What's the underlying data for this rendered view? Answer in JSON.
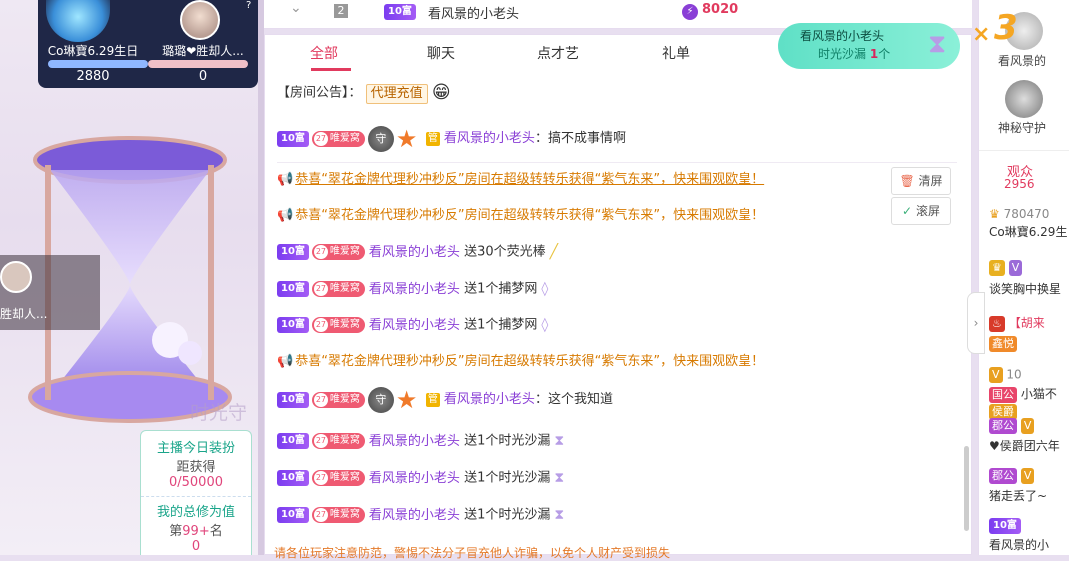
{
  "topbar": {
    "chevron": "⌄",
    "rank": "2",
    "level": "10富",
    "name": "看风景的小老头",
    "score": "8020"
  },
  "pk": {
    "left_name": "Co琳寶6.29生日",
    "left_score": "2880",
    "right_name": "璐璐❤胜却人...",
    "right_score": "0",
    "help": "?"
  },
  "stream": {
    "side_user": "胜却人...",
    "watermark": "时光守练",
    "card": {
      "line1": "主播今日装扮",
      "line2": "距获得",
      "line3": "0/50000",
      "line4": "我的总修为值",
      "line5_prefix": "第",
      "line5_rank": "99+",
      "line5_suffix": "名",
      "line6": "0"
    }
  },
  "tabs": [
    {
      "label": "全部"
    },
    {
      "label": "聊天"
    },
    {
      "label": "点才艺"
    },
    {
      "label": "礼单"
    }
  ],
  "notice": {
    "prefix": "【房间公告】：",
    "tag": "代理充值",
    "emoji": "😁"
  },
  "fan_level": "27",
  "fan_club": "唯爱窝",
  "user_name": "看风景的小老头",
  "user_level": "10富",
  "messages": [
    {
      "text": "：搞不成事情啊"
    },
    {
      "text": "恭喜“翠花金牌代理秒冲秒反”房间在超级转转乐获得“紫气东来”，快来围观欧皇！"
    },
    {
      "text": "恭喜“翠花金牌代理秒冲秒反”房间在超级转转乐获得“紫气东来”，快来围观欧皇！"
    },
    {
      "text": "送30个荧光棒"
    },
    {
      "text": "送1个捕梦网"
    },
    {
      "text": "送1个捕梦网"
    },
    {
      "text": "恭喜“翠花金牌代理秒冲秒反”房间在超级转转乐获得“紫气东来”，快来围观欧皇！"
    },
    {
      "text": "：这个我知道"
    },
    {
      "text": "送1个时光沙漏"
    },
    {
      "text": "送1个时光沙漏"
    },
    {
      "text": "送1个时光沙漏"
    }
  ],
  "buttons": {
    "clear": "清屏",
    "scroll": "滚屏"
  },
  "footer": "请各位玩家注意防范，警惕不法分子冒充他人诈骗，以免个人财产受到损失",
  "toast": {
    "line1": "看风景的小老头",
    "line2_prefix": "时光沙漏 ",
    "count": "1",
    "line2_suffix": "个",
    "multiplier_x": "×",
    "multiplier_n": "3"
  },
  "right": {
    "item1_label": "看风景的",
    "item2_label": "神秘守护",
    "viewers_title": "观众",
    "viewers_count": "2956",
    "rows": [
      {
        "text": "780470",
        "sub": "Co琳寶6.29生"
      },
      {
        "text": "谈笑胸中换星"
      },
      {
        "text": "【胡来",
        "tag": "鑫悦"
      },
      {
        "text": "10",
        "sub": "小猫不"
      },
      {
        "tag": "国公",
        "tag2": "侯爵"
      },
      {
        "tag": "郡公",
        "sub": "♥侯爵团六年"
      },
      {
        "tag": "郡公",
        "sub": "猪走丢了~"
      },
      {
        "text": "看风景的小"
      }
    ]
  },
  "colors": {
    "accent": "#e13a5e",
    "level": "#7b3df0",
    "system": "#d77a00",
    "toast": "#5fe0c6"
  }
}
